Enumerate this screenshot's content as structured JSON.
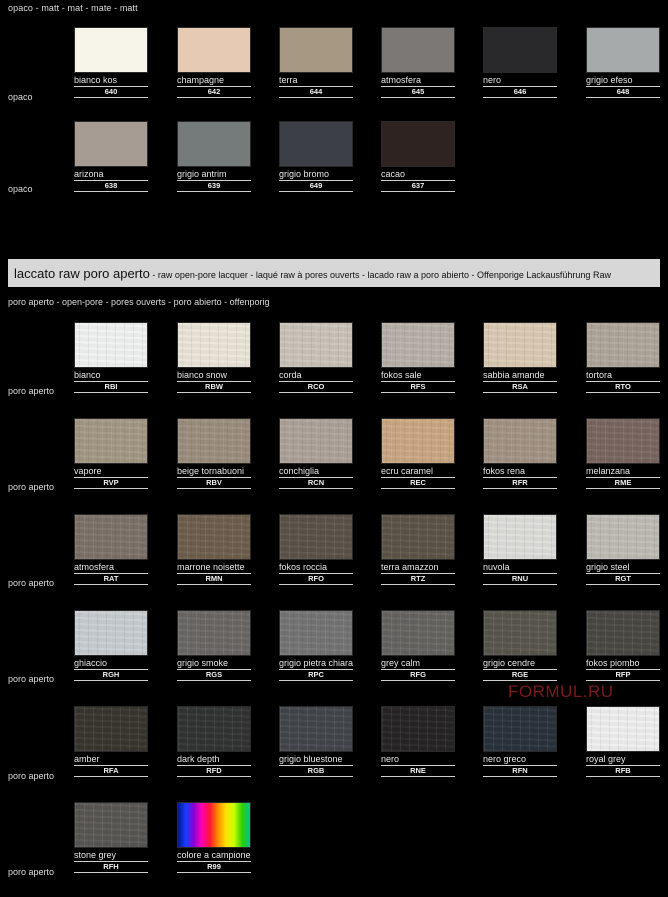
{
  "header": {
    "text": "opaco - matt - mat - mate - matt"
  },
  "opaco": {
    "row_label": "opaco",
    "rows": [
      [
        {
          "name": "bianco kos",
          "code": "640",
          "color": "#f7f5ea"
        },
        {
          "name": "champagne",
          "code": "642",
          "color": "#e6cab3"
        },
        {
          "name": "terra",
          "code": "644",
          "color": "#a69882"
        },
        {
          "name": "atmosfera",
          "code": "645",
          "color": "#7c7875"
        },
        {
          "name": "nero",
          "code": "646",
          "color": "#29292b"
        },
        {
          "name": "grigio efeso",
          "code": "648",
          "color": "#a7aaab"
        }
      ],
      [
        {
          "name": "arizona",
          "code": "638",
          "color": "#a69c93"
        },
        {
          "name": "grigio antrim",
          "code": "639",
          "color": "#757a7b"
        },
        {
          "name": "grigio bromo",
          "code": "649",
          "color": "#3c3f46"
        },
        {
          "name": "cacao",
          "code": "637",
          "color": "#2f2322"
        }
      ]
    ]
  },
  "laccato": {
    "band_title": "laccato raw poro aperto",
    "band_subtitle": " - raw open-pore lacquer - laqué raw à pores ouverts - lacado raw a poro abierto - Offenporige Lackausführung Raw",
    "section_subtitle": "poro aperto - open-pore - pores ouverts - poro abierto - offenporig",
    "row_label": "poro aperto",
    "rows": [
      [
        {
          "name": "bianco",
          "code": "RBI",
          "color": "#f1f2f2"
        },
        {
          "name": "bianco snow",
          "code": "RBW",
          "color": "#ebe6d8"
        },
        {
          "name": "corda",
          "code": "RCO",
          "color": "#cbc4ba"
        },
        {
          "name": "fokos sale",
          "code": "RFS",
          "color": "#b8b2aa"
        },
        {
          "name": "sabbia amande",
          "code": "RSA",
          "color": "#dccbb4"
        },
        {
          "name": "tortora",
          "code": "RTO",
          "color": "#b0a79c"
        }
      ],
      [
        {
          "name": "vapore",
          "code": "RVP",
          "color": "#a49985"
        },
        {
          "name": "beige tornabuoni",
          "code": "RBV",
          "color": "#9c8f7e"
        },
        {
          "name": "conchiglia",
          "code": "RCN",
          "color": "#aea39b"
        },
        {
          "name": "ecru caramel",
          "code": "REC",
          "color": "#cba883"
        },
        {
          "name": "fokos rena",
          "code": "RFR",
          "color": "#a39484"
        },
        {
          "name": "melanzana",
          "code": "RME",
          "color": "#7b6761"
        }
      ],
      [
        {
          "name": "atmosfera",
          "code": "RAT",
          "color": "#7e7269"
        },
        {
          "name": "marrone noisette",
          "code": "RMN",
          "color": "#6e5f4e"
        },
        {
          "name": "fokos roccia",
          "code": "RFO",
          "color": "#5c5249"
        },
        {
          "name": "terra amazzon",
          "code": "RTZ",
          "color": "#5e5448"
        },
        {
          "name": "nuvola",
          "code": "RNU",
          "color": "#dedfdb"
        },
        {
          "name": "grigio steel",
          "code": "RGT",
          "color": "#bfbcb6"
        }
      ],
      [
        {
          "name": "ghiaccio",
          "code": "RGH",
          "color": "#c9ced2"
        },
        {
          "name": "grigio smoke",
          "code": "RGS",
          "color": "#6b6866"
        },
        {
          "name": "grigio pietra chiara",
          "code": "RPC",
          "color": "#767575"
        },
        {
          "name": "grey calm",
          "code": "RFG",
          "color": "#676562"
        },
        {
          "name": "grigio cendre",
          "code": "RGE",
          "color": "#5a564e"
        },
        {
          "name": "fokos piombo",
          "code": "RFP",
          "color": "#4a4944"
        }
      ],
      [
        {
          "name": "amber",
          "code": "RFA",
          "color": "#39362f"
        },
        {
          "name": "dark depth",
          "code": "RFD",
          "color": "#323434"
        },
        {
          "name": "grigio bluestone",
          "code": "RGB",
          "color": "#43474c"
        },
        {
          "name": "nero",
          "code": "RNE",
          "color": "#262424"
        },
        {
          "name": "nero greco",
          "code": "RFN",
          "color": "#2a323b"
        },
        {
          "name": "royal grey",
          "code": "RFB",
          "color": "#eeefee"
        }
      ],
      [
        {
          "name": "stone grey",
          "code": "RFH",
          "color": "#5a5754"
        },
        {
          "name": "colore a campione",
          "code": "R99",
          "color": "rainbow"
        }
      ]
    ]
  },
  "watermark": "FORMUL.RU"
}
